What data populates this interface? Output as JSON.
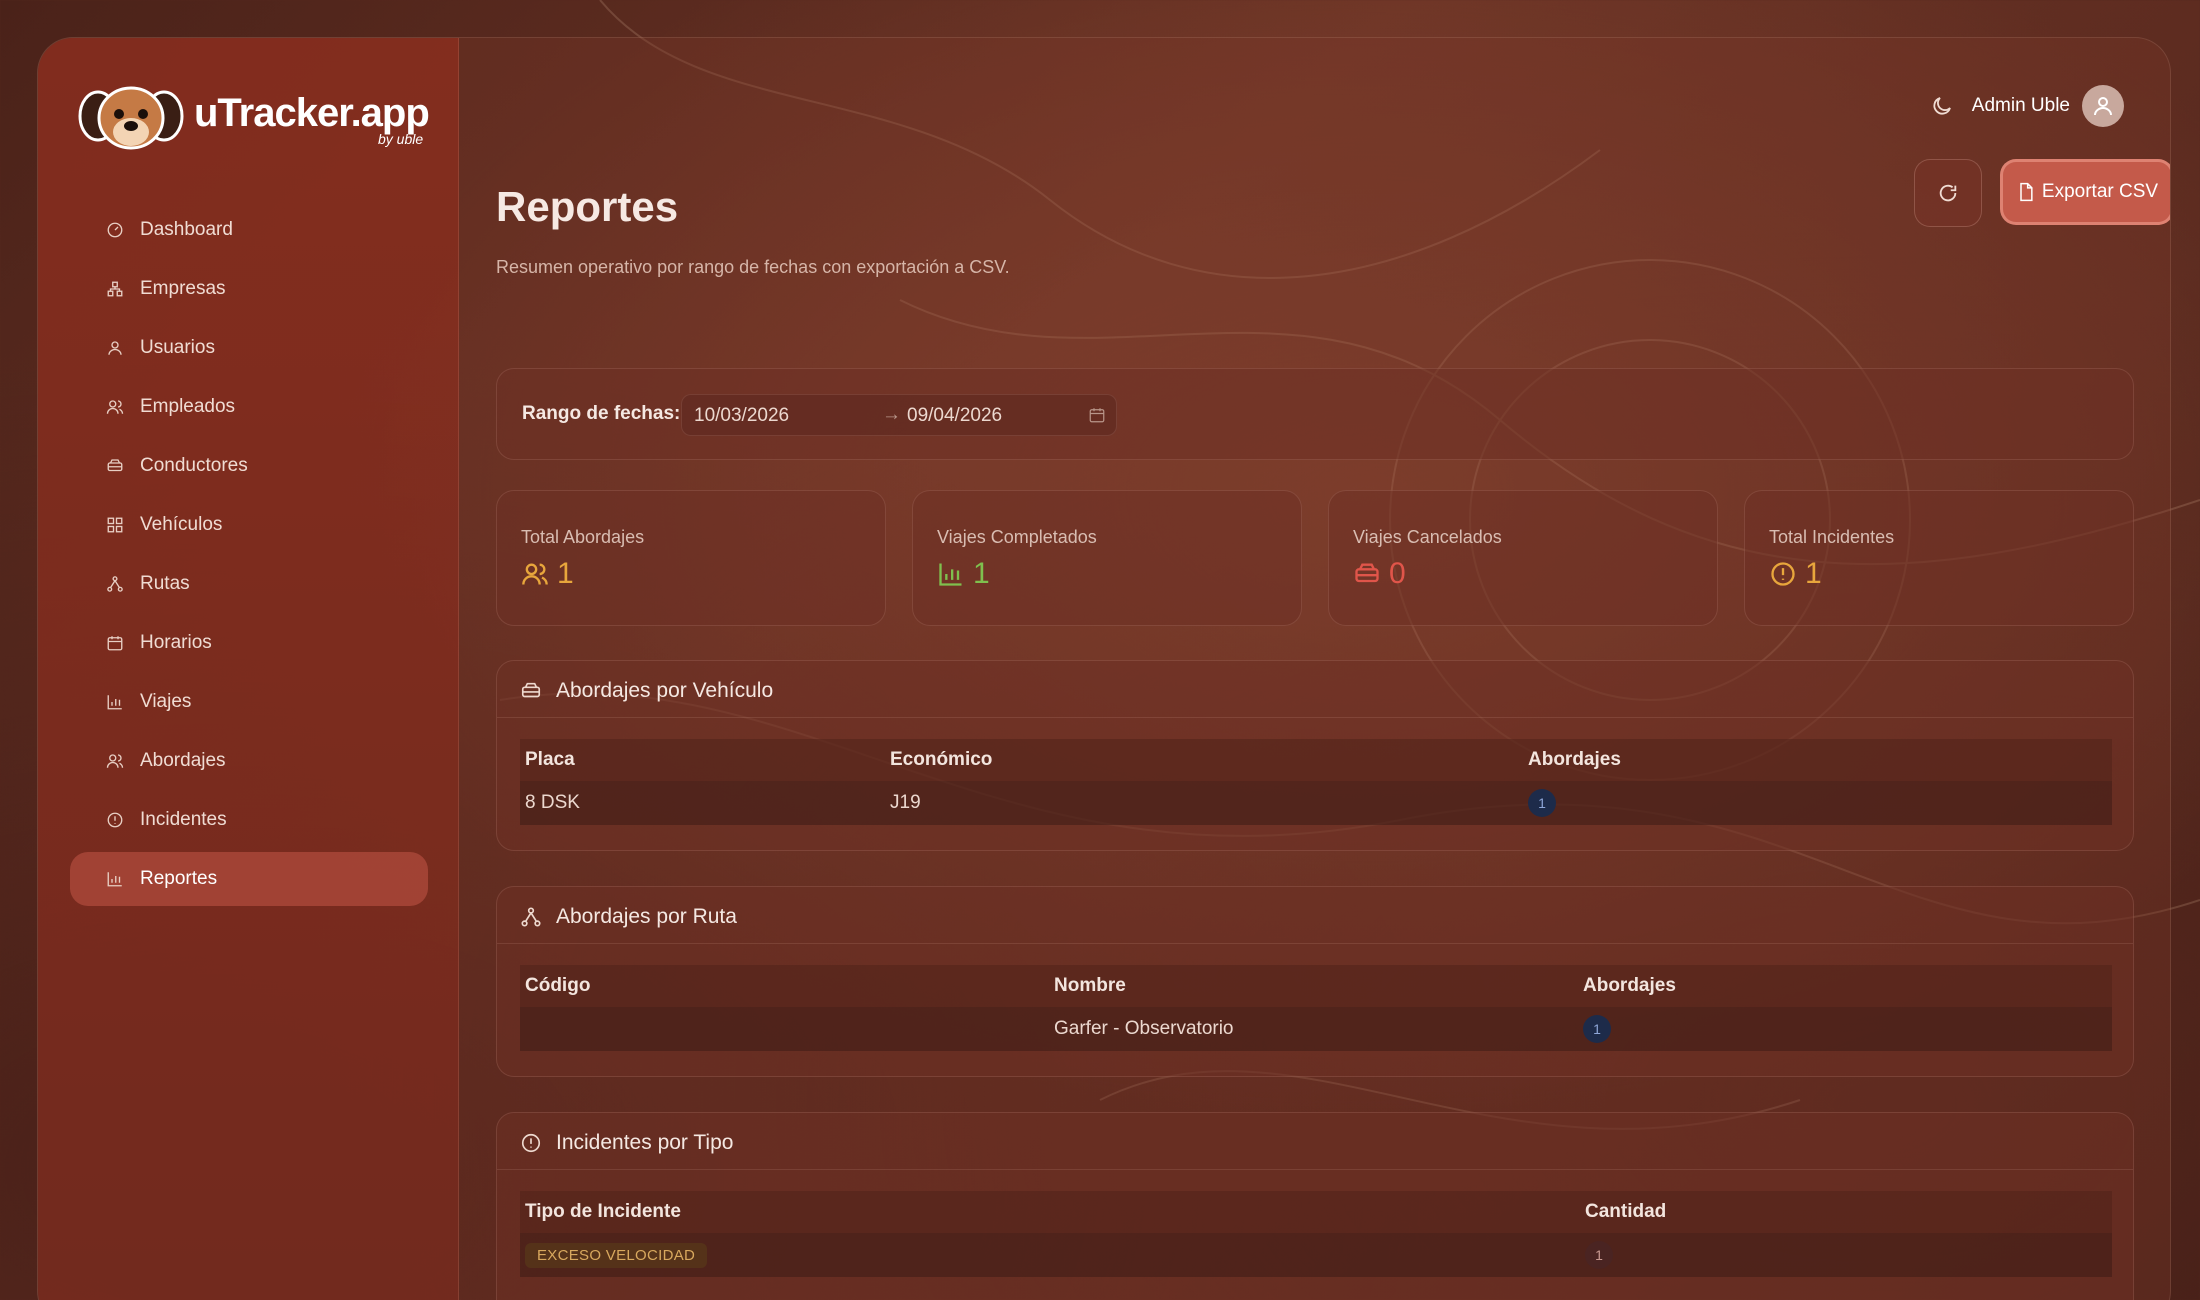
{
  "brand": {
    "name": "uTracker.app",
    "by": "by uble"
  },
  "sidebar": {
    "items": [
      {
        "label": "Dashboard",
        "icon": "dashboard-icon"
      },
      {
        "label": "Empresas",
        "icon": "building-icon"
      },
      {
        "label": "Usuarios",
        "icon": "user-icon"
      },
      {
        "label": "Empleados",
        "icon": "users-icon"
      },
      {
        "label": "Conductores",
        "icon": "car-icon"
      },
      {
        "label": "Vehículos",
        "icon": "grid-icon"
      },
      {
        "label": "Rutas",
        "icon": "route-icon"
      },
      {
        "label": "Horarios",
        "icon": "calendar-icon"
      },
      {
        "label": "Viajes",
        "icon": "chart-icon"
      },
      {
        "label": "Abordajes",
        "icon": "users-icon"
      },
      {
        "label": "Incidentes",
        "icon": "alert-icon"
      },
      {
        "label": "Reportes",
        "icon": "chart-icon",
        "active": true
      }
    ]
  },
  "header": {
    "user_name": "Admin Uble"
  },
  "page": {
    "title": "Reportes",
    "subtitle": "Resumen operativo por rango de fechas con exportación a CSV.",
    "export_label": "Exportar CSV"
  },
  "filters": {
    "label": "Rango de fechas:",
    "start": "10/03/2026",
    "end": "09/04/2026",
    "arrow": "→"
  },
  "stats": [
    {
      "label": "Total Abordajes",
      "value": "1",
      "icon": "users-icon",
      "color": "#e8a63c"
    },
    {
      "label": "Viajes Completados",
      "value": "1",
      "icon": "bar-chart-icon",
      "color": "#7fc04e"
    },
    {
      "label": "Viajes Cancelados",
      "value": "0",
      "icon": "car-icon",
      "color": "#e0554a"
    },
    {
      "label": "Total Incidentes",
      "value": "1",
      "icon": "alert-icon",
      "color": "#e8a63c"
    }
  ],
  "vehicles": {
    "title": "Abordajes por Vehículo",
    "headers": [
      "Placa",
      "Económico",
      "Abordajes"
    ],
    "rows": [
      {
        "placa": "8 DSK",
        "economico": "J19",
        "abordajes": "1"
      }
    ]
  },
  "routes": {
    "title": "Abordajes por Ruta",
    "headers": [
      "Código",
      "Nombre",
      "Abordajes"
    ],
    "rows": [
      {
        "codigo": "",
        "nombre": "Garfer - Observatorio",
        "abordajes": "1"
      }
    ]
  },
  "incidents": {
    "title": "Incidentes por Tipo",
    "headers": [
      "Tipo de Incidente",
      "Cantidad"
    ],
    "rows": [
      {
        "tipo": "EXCESO VELOCIDAD",
        "cantidad": "1"
      }
    ]
  }
}
